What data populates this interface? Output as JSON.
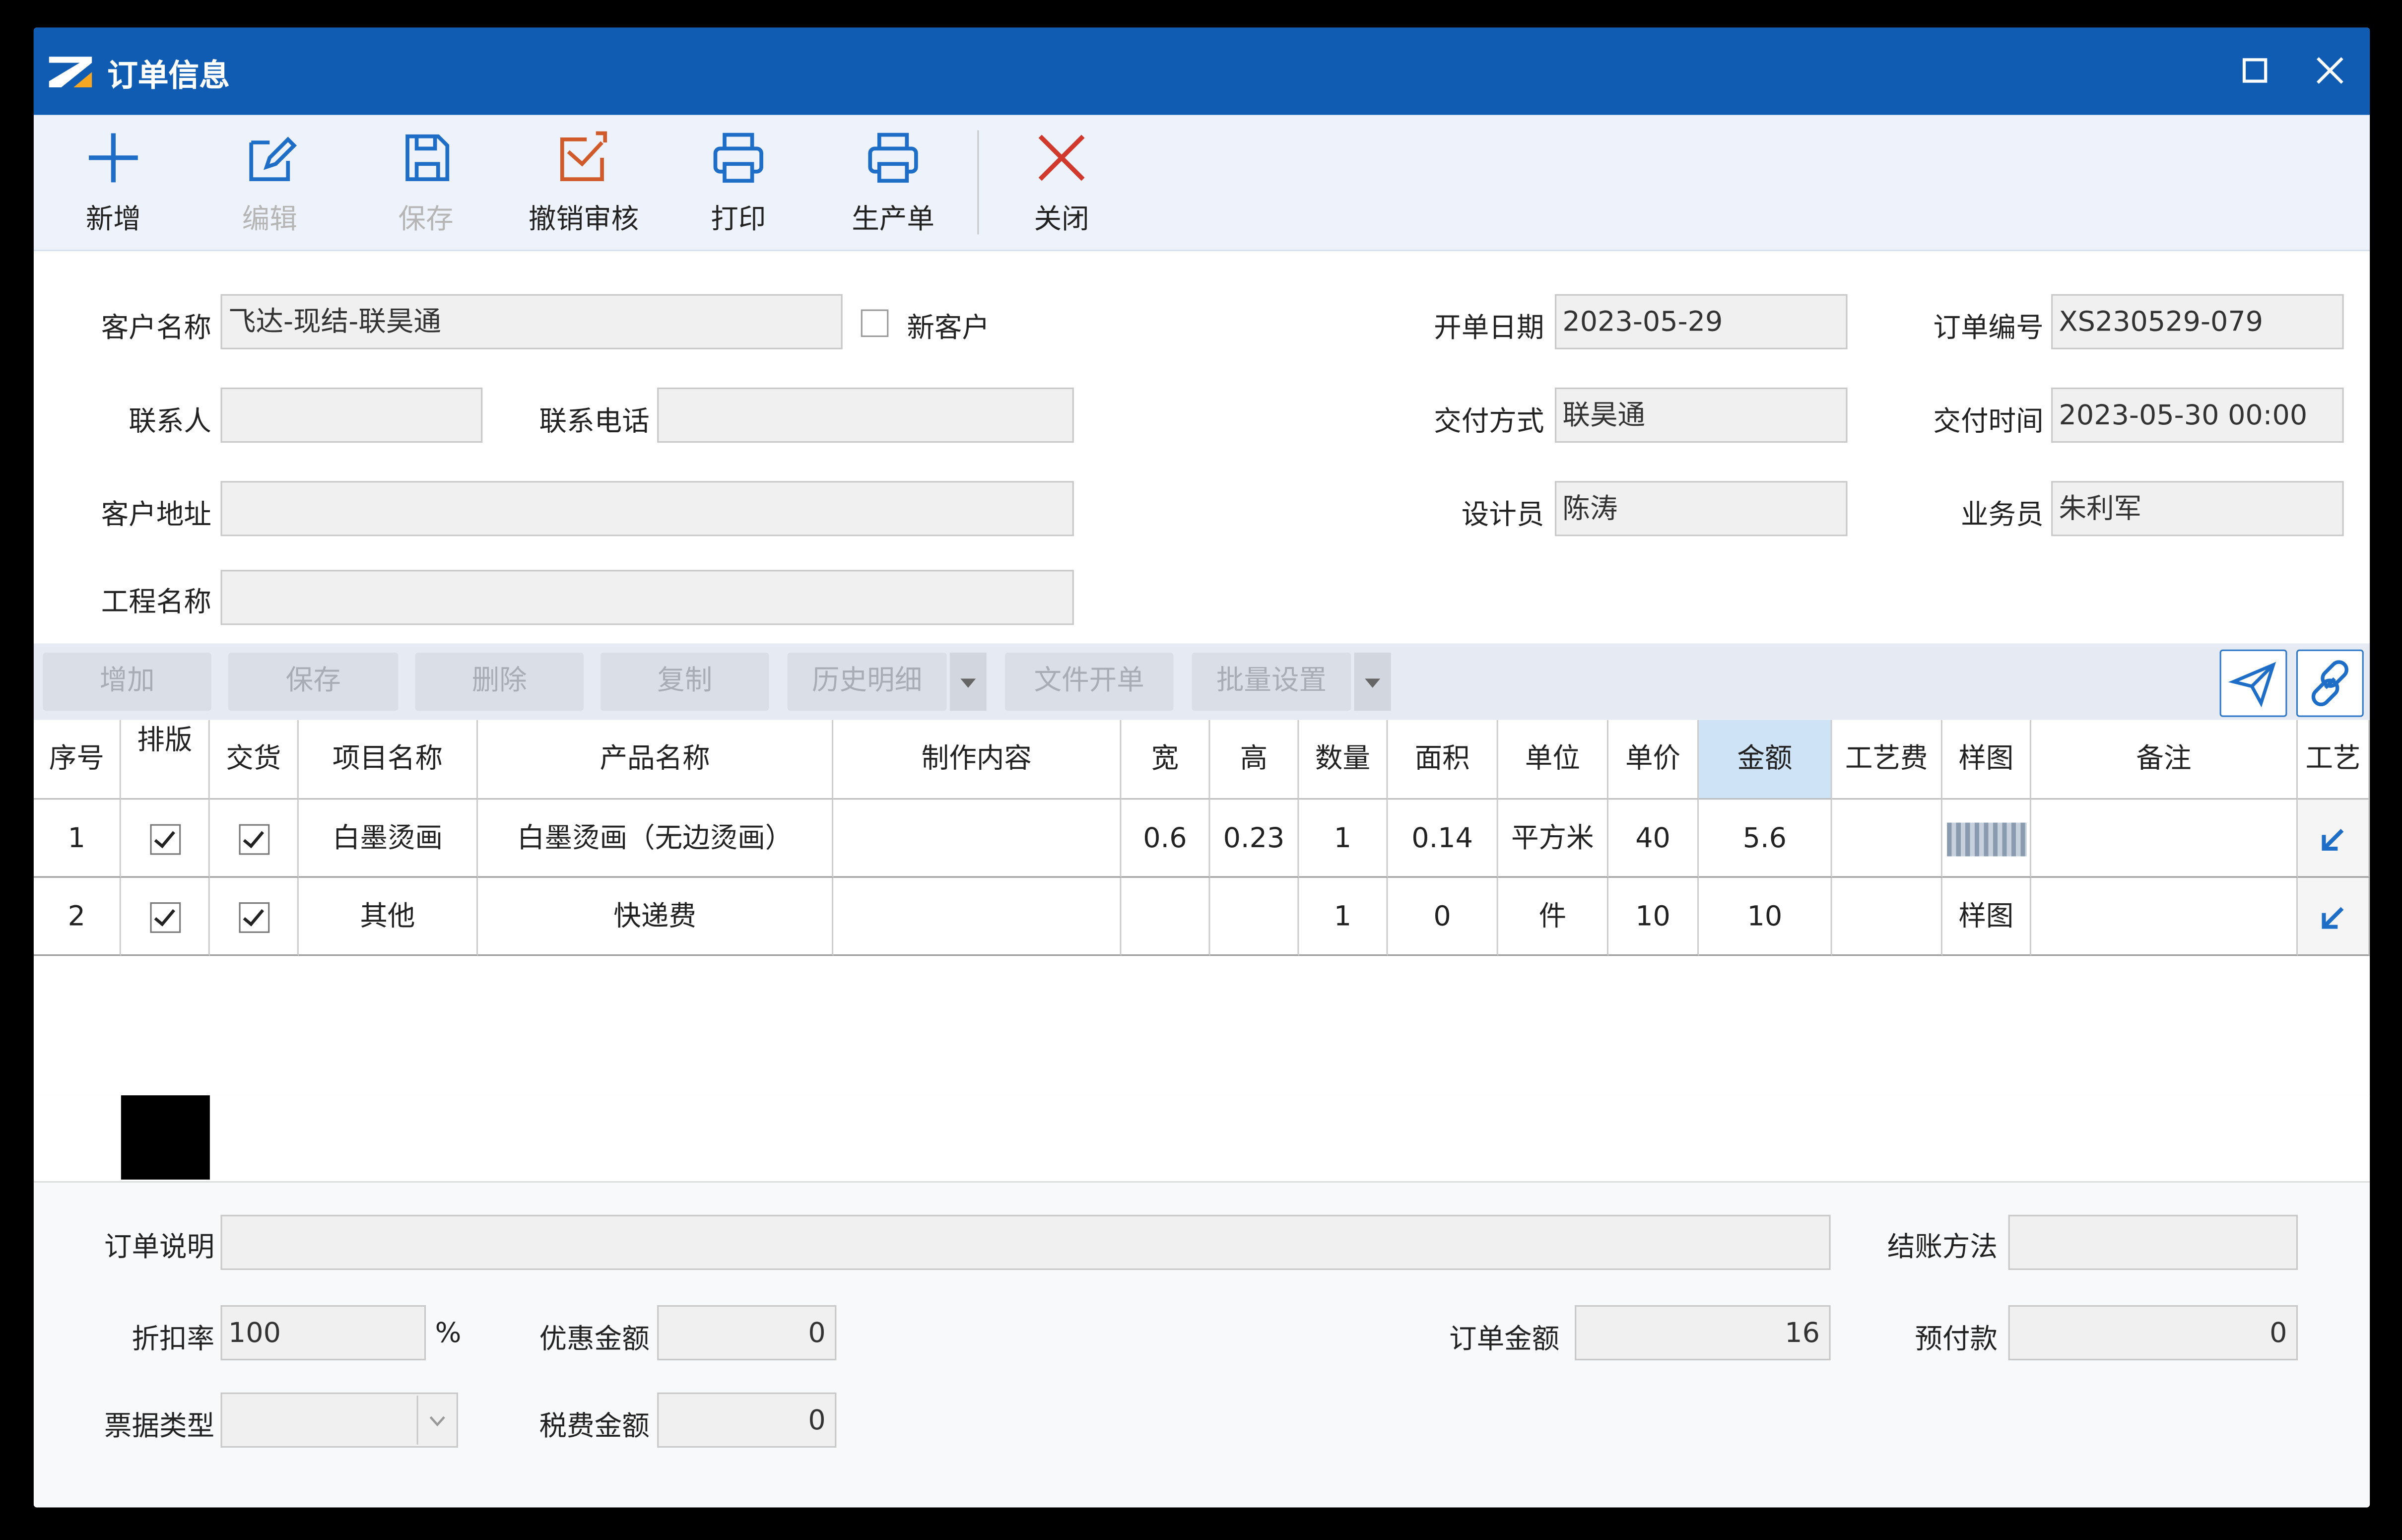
{
  "window": {
    "title": "订单信息"
  },
  "toolbar": {
    "new": "新增",
    "edit": "编辑",
    "save": "保存",
    "revoke": "撤销审核",
    "print": "打印",
    "production": "生产单",
    "close": "关闭"
  },
  "form": {
    "customer_label": "客户名称",
    "customer_value": "飞达-现结-联昊通",
    "new_customer": "新客户",
    "contact_label": "联系人",
    "contact_value": "",
    "phone_label": "联系电话",
    "phone_value": "",
    "address_label": "客户地址",
    "address_value": "",
    "project_label": "工程名称",
    "project_value": "",
    "date_label": "开单日期",
    "date_value": "2023-05-29",
    "order_no_label": "订单编号",
    "order_no_value": "XS230529-079",
    "delivery_label": "交付方式",
    "delivery_value": "联昊通",
    "delivery_time_label": "交付时间",
    "delivery_time_value": "2023-05-30 00:00",
    "designer_label": "设计员",
    "designer_value": "陈涛",
    "sales_label": "业务员",
    "sales_value": "朱利军"
  },
  "grid_toolbar": {
    "add": "增加",
    "save": "保存",
    "delete": "删除",
    "copy": "复制",
    "history": "历史明细",
    "file_order": "文件开单",
    "batch": "批量设置"
  },
  "table": {
    "headers": [
      "序号",
      "排版",
      "交货",
      "项目名称",
      "产品名称",
      "制作内容",
      "宽",
      "高",
      "数量",
      "面积",
      "单位",
      "单价",
      "金额",
      "工艺费",
      "样图",
      "备注",
      "工艺"
    ],
    "rows": [
      [
        "1",
        "",
        "",
        "白墨烫画",
        "白墨烫画（无边烫画）",
        "",
        "0.6",
        "0.23",
        "1",
        "0.14",
        "平方米",
        "40",
        "5.6",
        "",
        "",
        "",
        ""
      ],
      [
        "2",
        "",
        "",
        "其他",
        "快递费",
        "",
        "",
        "",
        "1",
        "0",
        "件",
        "10",
        "10",
        "",
        "样图",
        "",
        ""
      ]
    ]
  },
  "bottom": {
    "remark_label": "订单说明",
    "remark_value": "",
    "settle_label": "结账方法",
    "settle_value": "",
    "discount_label": "折扣率",
    "discount_value": "100",
    "percent": "%",
    "promo_label": "优惠金额",
    "promo_value": "0",
    "order_amount_label": "订单金额",
    "order_amount_value": "16",
    "prepay_label": "预付款",
    "prepay_value": "0",
    "invoice_label": "票据类型",
    "invoice_value": "",
    "tax_label": "税费金额",
    "tax_value": "0"
  }
}
